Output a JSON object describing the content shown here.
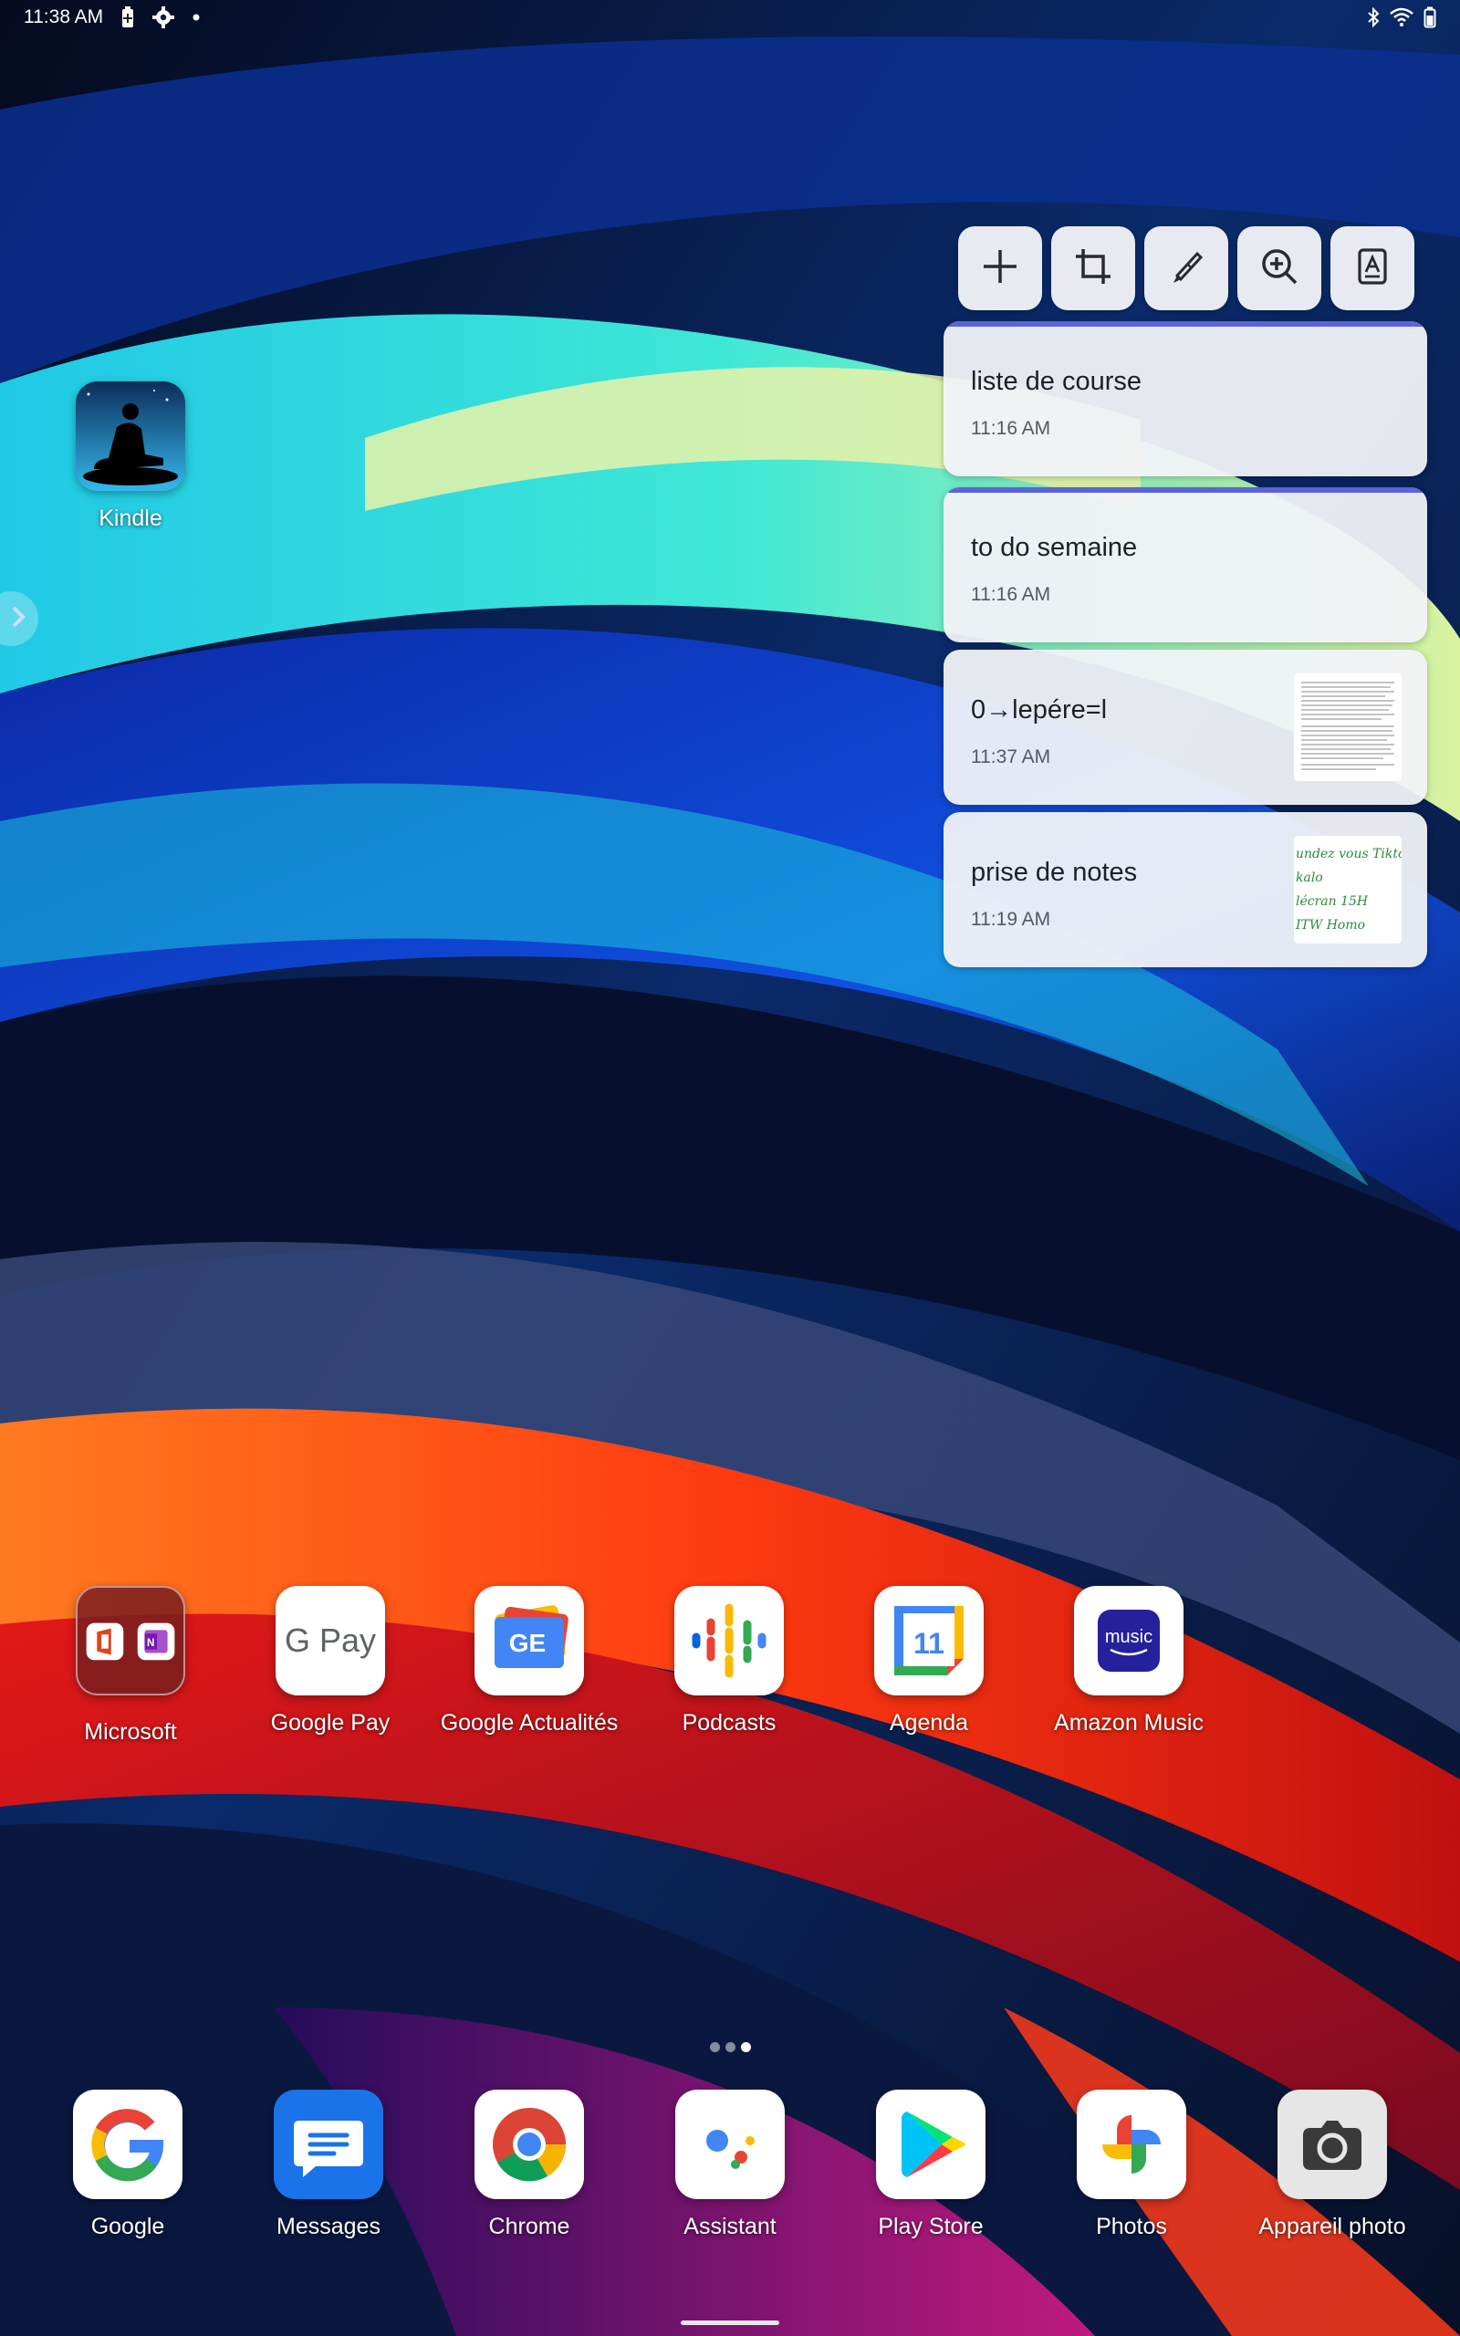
{
  "status_bar": {
    "time": "11:38 AM",
    "left_icons": [
      "battery-saver-icon",
      "settings-icon",
      "dot-icon"
    ],
    "right_icons": [
      "bluetooth-icon",
      "wifi-icon",
      "battery-icon"
    ]
  },
  "home": {
    "kindle": {
      "label": "Kindle",
      "icon": "kindle-icon"
    },
    "app_row": [
      {
        "label": "Microsoft",
        "icon": "microsoft-folder-icon"
      },
      {
        "label": "Google Pay",
        "icon": "google-pay-icon",
        "icon_text": "G Pay"
      },
      {
        "label": "Google Actualités",
        "icon": "google-news-icon",
        "icon_text": "GE"
      },
      {
        "label": "Podcasts",
        "icon": "podcasts-icon"
      },
      {
        "label": "Agenda",
        "icon": "calendar-icon",
        "icon_text": "11"
      },
      {
        "label": "Amazon Music",
        "icon": "amazon-music-icon",
        "icon_text": "music"
      }
    ],
    "page_indicator": {
      "pages": 3,
      "current": 3
    }
  },
  "dock": [
    {
      "label": "Google",
      "icon": "google-icon"
    },
    {
      "label": "Messages",
      "icon": "messages-icon"
    },
    {
      "label": "Chrome",
      "icon": "chrome-icon"
    },
    {
      "label": "Assistant",
      "icon": "assistant-icon"
    },
    {
      "label": "Play Store",
      "icon": "play-store-icon"
    },
    {
      "label": "Photos",
      "icon": "photos-icon"
    },
    {
      "label": "Appareil photo",
      "icon": "camera-icon"
    }
  ],
  "notes_widget": {
    "toolbar": [
      "add-icon",
      "crop-icon",
      "pen-icon",
      "zoom-in-icon",
      "document-icon"
    ],
    "notes": [
      {
        "title": "liste de course",
        "time": "11:16 AM",
        "accent": true,
        "thumb": "none"
      },
      {
        "title": "to do semaine",
        "time": "11:16 AM",
        "accent": true,
        "thumb": "none"
      },
      {
        "title": "0→lepére=l",
        "time": "11:37 AM",
        "accent": false,
        "thumb": "text-page"
      },
      {
        "title": "prise de notes",
        "time": "11:19 AM",
        "accent": false,
        "thumb": "handwriting",
        "thumb_lines": [
          "undez vous Tiktok",
          "kalo",
          "lécran 15H",
          "ITW Homo"
        ]
      }
    ]
  },
  "colors": {
    "note_accent": "#5b63d9",
    "handwriting": "#2a8b3a"
  }
}
